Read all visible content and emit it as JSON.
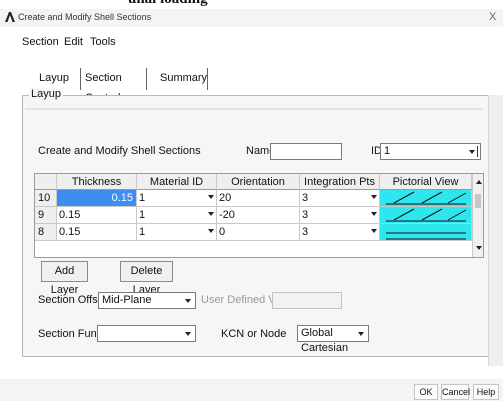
{
  "top_cut_text": "unal loading",
  "window": {
    "title": "Create and Modify Shell Sections",
    "close_label": "X"
  },
  "menu": [
    "Section",
    "Edit",
    "Tools"
  ],
  "tabs": [
    "Layup",
    "Section Controls",
    "Summary"
  ],
  "group_label": "Layup",
  "form": {
    "section_label": "Create and Modify Shell Sections",
    "name_label": "Name",
    "name_value": "",
    "id_label": "ID",
    "id_value": "1"
  },
  "table": {
    "columns": [
      "Thickness",
      "Material ID",
      "Orientation",
      "Integration Pts",
      "Pictorial View"
    ],
    "rows": [
      {
        "num": "10",
        "thickness": "0.15",
        "material": "1",
        "orientation": "20",
        "integration": "3"
      },
      {
        "num": "9",
        "thickness": "0.15",
        "material": "1",
        "orientation": "-20",
        "integration": "3"
      },
      {
        "num": "8",
        "thickness": "0.15",
        "material": "1",
        "orientation": "0",
        "integration": "3"
      }
    ]
  },
  "buttons": {
    "add_layer": "Add Layer",
    "delete_layer": "Delete Layer"
  },
  "section_offset": {
    "label": "Section Offset",
    "value": "Mid-Plane",
    "user_defined_label": "User Defined Value",
    "user_defined_value": ""
  },
  "section_function": {
    "label": "Section Function",
    "value": ""
  },
  "kcn": {
    "label": "KCN or Node",
    "value": "Global Cartesian"
  },
  "footer": {
    "ok": "OK",
    "cancel": "Cancel",
    "help": "Help"
  },
  "colors": {
    "selected_cell": "#3d8ef0",
    "pictorial": "#2fe6ee"
  }
}
